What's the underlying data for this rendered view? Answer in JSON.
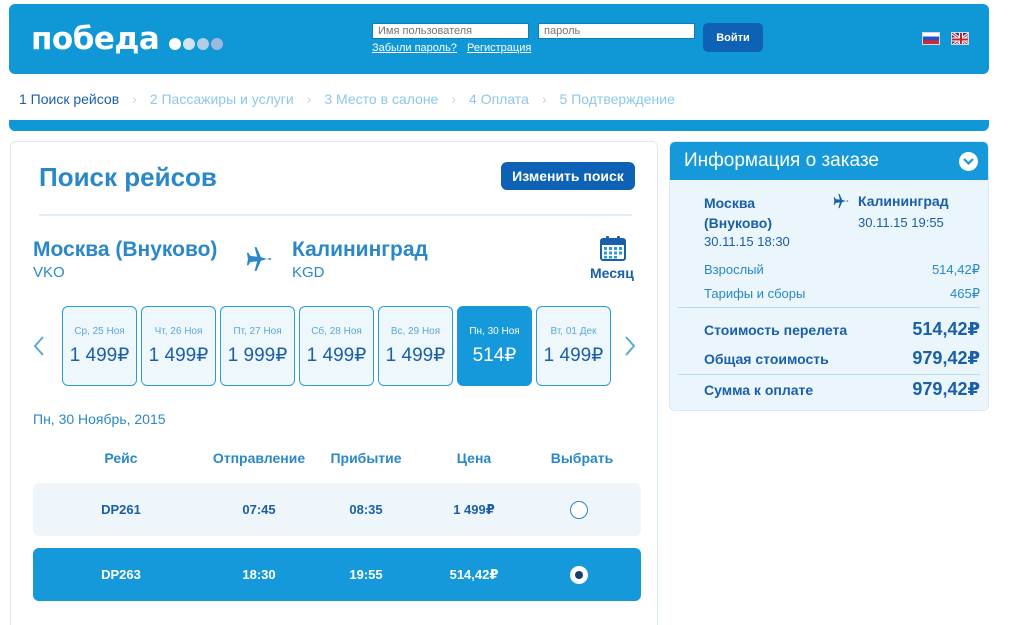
{
  "header": {
    "logo": "победа",
    "username_placeholder": "Имя пользователя",
    "password_placeholder": "пароль",
    "forgot_link": "Забыли пароль?",
    "register_link": "Регистрация",
    "login_button": "Войти",
    "languages": [
      "ru",
      "en"
    ],
    "colors": {
      "brand": "#0f97d6",
      "button": "#0d62b5"
    }
  },
  "steps": [
    {
      "label": "1 Поиск рейсов",
      "active": true
    },
    {
      "label": "2 Пассажиры и услуги",
      "active": false
    },
    {
      "label": "3 Место в салоне",
      "active": false
    },
    {
      "label": "4 Оплата",
      "active": false
    },
    {
      "label": "5 Подтверждение",
      "active": false
    }
  ],
  "search": {
    "title": "Поиск рейсов",
    "change_button": "Изменить поиск",
    "from_city": "Москва (Внуково)",
    "from_code": "VKO",
    "to_city": "Калининград",
    "to_code": "KGD",
    "month_label": "Месяц",
    "dates": [
      {
        "day": "Ср, 25 Ноя",
        "price": "1 499₽",
        "selected": false
      },
      {
        "day": "Чт, 26 Ноя",
        "price": "1 499₽",
        "selected": false
      },
      {
        "day": "Пт, 27 Ноя",
        "price": "1 999₽",
        "selected": false
      },
      {
        "day": "Сб, 28 Ноя",
        "price": "1 499₽",
        "selected": false
      },
      {
        "day": "Вс, 29 Ноя",
        "price": "1 499₽",
        "selected": false
      },
      {
        "day": "Пн, 30 Ноя",
        "price": "514₽",
        "selected": true
      },
      {
        "day": "Вт, 01 Дек",
        "price": "1 499₽",
        "selected": false
      }
    ],
    "selected_date": "Пн, 30 Ноябрь, 2015"
  },
  "table": {
    "headers": [
      "Рейс",
      "Отправление",
      "Прибытие",
      "Цена",
      "Выбрать"
    ],
    "rows": [
      {
        "flight": "DP261",
        "depart": "07:45",
        "arrive": "08:35",
        "price": "1 499₽",
        "selected": false
      },
      {
        "flight": "DP263",
        "depart": "18:30",
        "arrive": "19:55",
        "price": "514,42₽",
        "selected": true
      }
    ]
  },
  "order": {
    "title": "Информация о заказе",
    "from_city": "Москва (Внуково)",
    "from_datetime": "30.11.15 18:30",
    "to_city": "Калининград",
    "to_datetime": "30.11.15 19:55",
    "adult_label": "Взрослый",
    "adult_value": "514,42₽",
    "fees_label": "Тарифы и сборы",
    "fees_value": "465₽",
    "flight_cost_label": "Стоимость перелета",
    "flight_cost_value": "514,42₽",
    "total_label": "Общая стоимость",
    "total_value": "979,42₽",
    "pay_label": "Сумма к оплате",
    "pay_value": "979,42₽"
  }
}
